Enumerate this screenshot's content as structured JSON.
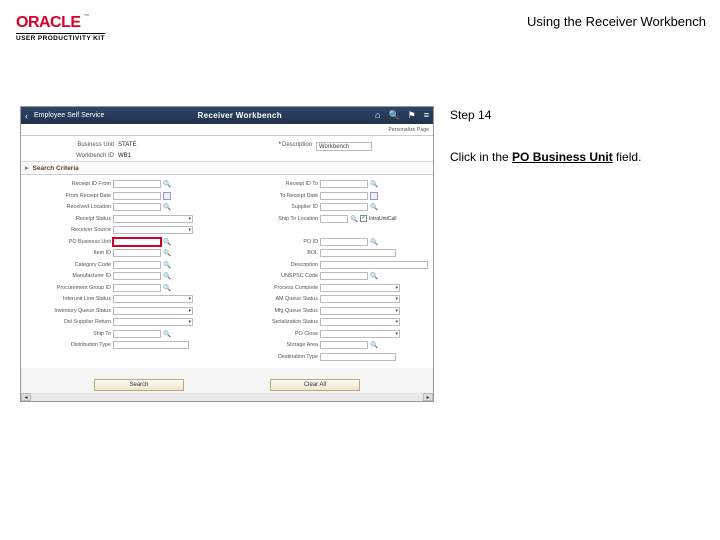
{
  "header": {
    "brand_name": "ORACLE",
    "brand_tm": "™",
    "subbrand": "USER PRODUCTIVITY KIT",
    "doc_title": "Using the Receiver Workbench"
  },
  "instructions": {
    "step_label": "Step 14",
    "body_prefix": "Click in the ",
    "body_bold": "PO Business Unit",
    "body_suffix": " field."
  },
  "app": {
    "bar": {
      "back_label": "Employee Self Service",
      "module_title": "Receiver Workbench",
      "icons": {
        "home": "home-icon",
        "search": "search-icon",
        "flag": "flag-icon",
        "menu": "menu-icon"
      },
      "personalize_label": "Personalize Page"
    },
    "page_head": {
      "left": [
        {
          "label": "Business Unit",
          "value": "STATE"
        },
        {
          "label": "Workbench ID",
          "value": "WB1"
        }
      ],
      "right": [
        {
          "label": "Description",
          "value": "Workbench",
          "required": true
        }
      ]
    },
    "search_section": {
      "title": "Search Criteria"
    },
    "criteria_left": [
      {
        "label": "Receipt ID From",
        "ctrl": "input+lookup"
      },
      {
        "label": "From Receipt Date",
        "ctrl": "input+cal"
      },
      {
        "label": "Received Location",
        "ctrl": "input+lookup"
      },
      {
        "label": "Receipt Status",
        "ctrl": "select"
      },
      {
        "label": "Receiver Source",
        "ctrl": "select"
      },
      {
        "label": "PO Business Unit",
        "ctrl": "input+lookup",
        "highlight": true
      },
      {
        "label": "Item ID",
        "ctrl": "input+lookup"
      },
      {
        "label": "Category Code",
        "ctrl": "input+lookup"
      },
      {
        "label": "Manufacturer ID",
        "ctrl": "input+lookup"
      },
      {
        "label": "Procurement Group ID",
        "ctrl": "input+lookup"
      },
      {
        "label": "Interunit Line Status",
        "ctrl": "select"
      },
      {
        "label": "Inventory Queue Status",
        "ctrl": "select"
      },
      {
        "label": "Del Supplier Return",
        "ctrl": "select"
      },
      {
        "label": "Ship To",
        "ctrl": "input+lookup"
      },
      {
        "label": "Distribution Type",
        "ctrl": "input"
      }
    ],
    "criteria_right": [
      {
        "label": "Receipt ID To",
        "ctrl": "input+lookup"
      },
      {
        "label": "To Receipt Date",
        "ctrl": "input+cal"
      },
      {
        "label": "Supplier ID",
        "ctrl": "input+lookup"
      },
      {
        "label": "Ship To Location",
        "ctrl": "input+lookup_chk",
        "chk_label": "IntraUnitCall"
      },
      {
        "label": "",
        "ctrl": "blank"
      },
      {
        "label": "PO ID",
        "ctrl": "input+lookup"
      },
      {
        "label": "BOL",
        "ctrl": "input"
      },
      {
        "label": "Description",
        "ctrl": "input_lg"
      },
      {
        "label": "UNSPSC Code",
        "ctrl": "input+lookup"
      },
      {
        "label": "Process Complete",
        "ctrl": "select"
      },
      {
        "label": "AM Queue Status",
        "ctrl": "select"
      },
      {
        "label": "Mfg Queue Status",
        "ctrl": "select"
      },
      {
        "label": "Serialization Status",
        "ctrl": "select"
      },
      {
        "label": "PO Close",
        "ctrl": "select"
      },
      {
        "label": "Storage Area",
        "ctrl": "input+lookup"
      },
      {
        "label": "Destination Type",
        "ctrl": "input"
      }
    ],
    "buttons": {
      "search": "Search",
      "clear": "Clear All"
    },
    "highlight_target": "po-business-unit-input"
  }
}
